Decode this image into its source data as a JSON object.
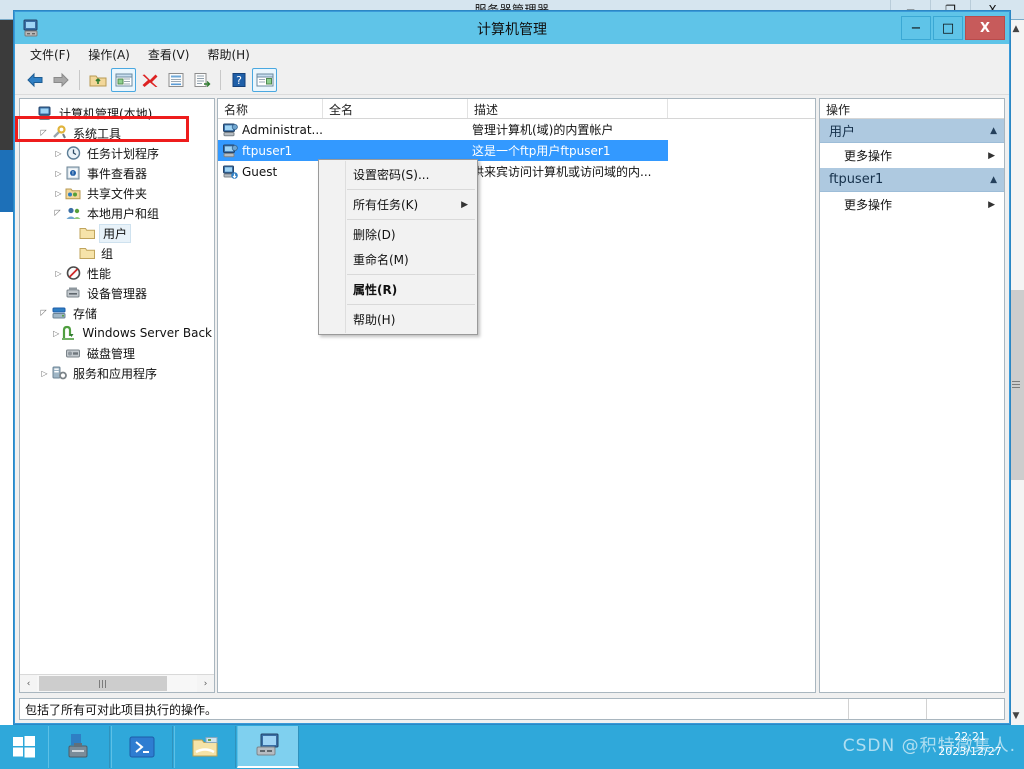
{
  "background_window": {
    "title": "服务器管理器",
    "minimize_label": "−",
    "maximize_label": "❐",
    "close_label": "X"
  },
  "window": {
    "title": "计算机管理",
    "icon": "computer-management-icon",
    "minimize_label": "−",
    "maximize_label": "□",
    "close_label": "X"
  },
  "menubar": {
    "items": [
      {
        "label": "文件(F)",
        "name": "menu-file"
      },
      {
        "label": "操作(A)",
        "name": "menu-action"
      },
      {
        "label": "查看(V)",
        "name": "menu-view"
      },
      {
        "label": "帮助(H)",
        "name": "menu-help"
      }
    ]
  },
  "toolbar": {
    "buttons": [
      {
        "icon": "back-arrow-icon",
        "framed": false
      },
      {
        "icon": "forward-arrow-icon",
        "framed": false
      },
      {
        "icon": "up-folder-icon",
        "framed": false
      },
      {
        "icon": "show-tree-icon",
        "framed": true
      },
      {
        "icon": "delete-icon",
        "framed": false
      },
      {
        "icon": "properties-icon",
        "framed": false
      },
      {
        "icon": "export-list-icon",
        "framed": false
      },
      {
        "icon": "help-icon",
        "framed": false
      },
      {
        "icon": "show-action-pane-icon",
        "framed": true
      }
    ]
  },
  "tree": {
    "nodes": [
      {
        "label": "计算机管理(本地)",
        "indent": 0,
        "expander": "",
        "icon": "computer-icon",
        "selected": false
      },
      {
        "label": "系统工具",
        "indent": 1,
        "expander": "▲",
        "icon": "tools-icon",
        "selected": false
      },
      {
        "label": "任务计划程序",
        "indent": 2,
        "expander": "▶",
        "icon": "clock-icon",
        "selected": false
      },
      {
        "label": "事件查看器",
        "indent": 2,
        "expander": "▶",
        "icon": "event-viewer-icon",
        "selected": false
      },
      {
        "label": "共享文件夹",
        "indent": 2,
        "expander": "▶",
        "icon": "shared-folder-icon",
        "selected": false
      },
      {
        "label": "本地用户和组",
        "indent": 2,
        "expander": "▲",
        "icon": "users-groups-icon",
        "selected": false
      },
      {
        "label": "用户",
        "indent": 3,
        "expander": "",
        "icon": "folder-icon",
        "selected": true
      },
      {
        "label": "组",
        "indent": 3,
        "expander": "",
        "icon": "folder-icon",
        "selected": false
      },
      {
        "label": "性能",
        "indent": 2,
        "expander": "▶",
        "icon": "performance-icon",
        "selected": false
      },
      {
        "label": "设备管理器",
        "indent": 2,
        "expander": "",
        "icon": "device-manager-icon",
        "selected": false
      },
      {
        "label": "存储",
        "indent": 1,
        "expander": "▲",
        "icon": "storage-icon",
        "selected": false
      },
      {
        "label": "Windows Server Back",
        "indent": 2,
        "expander": "▶",
        "icon": "backup-icon",
        "selected": false
      },
      {
        "label": "磁盘管理",
        "indent": 2,
        "expander": "",
        "icon": "disk-management-icon",
        "selected": false
      },
      {
        "label": "服务和应用程序",
        "indent": 1,
        "expander": "▶",
        "icon": "services-icon",
        "selected": false
      }
    ],
    "hscroll": {
      "left_arrow": "‹",
      "right_arrow": "›"
    }
  },
  "list": {
    "columns": [
      "名称",
      "全名",
      "描述",
      ""
    ],
    "rows": [
      {
        "name": "Administrat...",
        "fullname": "",
        "description": "管理计算机(域)的内置帐户",
        "icon": "user-icon",
        "selected": false
      },
      {
        "name": "ftpuser1",
        "fullname": "",
        "description": "这是一个ftp用户ftpuser1",
        "icon": "user-icon",
        "selected": true
      },
      {
        "name": "Guest",
        "fullname": "",
        "description": "供来宾访问计算机或访问域的内...",
        "icon": "guest-user-icon",
        "selected": false
      }
    ]
  },
  "context_menu": {
    "items": [
      {
        "label": "设置密码(S)...",
        "submenu": false,
        "separator_after": true,
        "highlighted": false
      },
      {
        "label": "所有任务(K)",
        "submenu": true,
        "separator_after": true,
        "highlighted": false
      },
      {
        "label": "删除(D)",
        "submenu": false,
        "separator_after": false,
        "highlighted": false
      },
      {
        "label": "重命名(M)",
        "submenu": false,
        "separator_after": true,
        "highlighted": false
      },
      {
        "label": "属性(R)",
        "submenu": false,
        "separator_after": true,
        "highlighted": true
      },
      {
        "label": "帮助(H)",
        "submenu": false,
        "separator_after": false,
        "highlighted": false
      }
    ],
    "highlight_color": "#ee1c1c",
    "submenu_arrow": "▶"
  },
  "action_pane": {
    "header": "操作",
    "groups": [
      {
        "title": "用户",
        "collapse_arrow": "▲",
        "items": [
          {
            "label": "更多操作",
            "arrow": "▶"
          }
        ]
      },
      {
        "title": "ftpuser1",
        "collapse_arrow": "▲",
        "items": [
          {
            "label": "更多操作",
            "arrow": "▶"
          }
        ]
      }
    ]
  },
  "status_bar": {
    "text": "包括了所有可对此项目执行的操作。"
  },
  "taskbar": {
    "start": "start-button",
    "tasks": [
      {
        "name": "server-manager-task",
        "icon": "server-manager-icon",
        "active": false
      },
      {
        "name": "powershell-task",
        "icon": "powershell-icon",
        "active": false
      },
      {
        "name": "file-explorer-task",
        "icon": "file-explorer-icon",
        "active": false
      },
      {
        "name": "computer-management-task",
        "icon": "computer-management-icon",
        "active": true
      }
    ],
    "clock": {
      "time": "22:21",
      "date": "2023/12/27"
    },
    "watermark": "CSDN @积特微集人."
  }
}
